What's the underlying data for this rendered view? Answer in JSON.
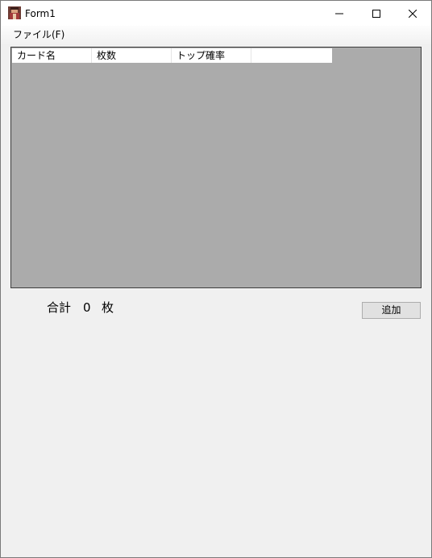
{
  "window": {
    "title": "Form1"
  },
  "icons": {
    "app": "card-character-icon",
    "minimize": "minimize-icon",
    "maximize": "maximize-icon",
    "close": "close-icon"
  },
  "menu": {
    "file": "ファイル(F)"
  },
  "grid": {
    "columns": [
      "カード名",
      "枚数",
      "トップ確率",
      ""
    ],
    "rows": []
  },
  "summary": {
    "label": "合計",
    "count": "0",
    "unit": "枚"
  },
  "buttons": {
    "add": "追加"
  }
}
